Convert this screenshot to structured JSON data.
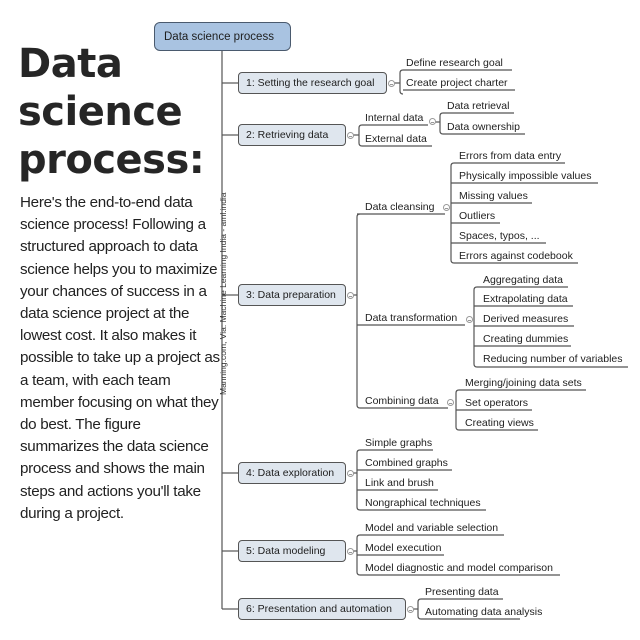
{
  "heading": {
    "title_lines": [
      "Data",
      "science",
      "process:"
    ],
    "description": "Here's the end-to-end data science process! Following a structured approach to data science helps you to maximize your chances of success in a data science project at the lowest cost. It also makes it possible to take up a project as a team, with each team member focusing on what they do best. The figure summarizes the data science process and shows the main steps and actions you'll take during a project."
  },
  "mindmap": {
    "root": "Data science process",
    "credit": "Manning.com, Via: Machine Learning India - aml.india",
    "steps": [
      {
        "label": "1: Setting the research goal",
        "children": [
          "Define research goal",
          "Create project charter"
        ]
      },
      {
        "label": "2: Retrieving data",
        "children": [
          {
            "label": "Internal data",
            "children": [
              "Data retrieval",
              "Data ownership"
            ]
          },
          {
            "label": "External data"
          }
        ]
      },
      {
        "label": "3: Data preparation",
        "children": [
          {
            "label": "Data cleansing",
            "children": [
              "Errors from data entry",
              "Physically impossible values",
              "Missing values",
              "Outliers",
              "Spaces, typos, ...",
              "Errors against codebook"
            ]
          },
          {
            "label": "Data transformation",
            "children": [
              "Aggregating data",
              "Extrapolating data",
              "Derived measures",
              "Creating dummies",
              "Reducing number of variables"
            ]
          },
          {
            "label": "Combining data",
            "children": [
              "Merging/joining data sets",
              "Set operators",
              "Creating views"
            ]
          }
        ]
      },
      {
        "label": "4: Data exploration",
        "children": [
          "Simple graphs",
          "Combined graphs",
          "Link and brush",
          "Nongraphical techniques"
        ]
      },
      {
        "label": "5: Data modeling",
        "children": [
          "Model and variable selection",
          "Model execution",
          "Model diagnostic and model comparison"
        ]
      },
      {
        "label": "6: Presentation and automation",
        "children": [
          "Presenting data",
          "Automating data analysis"
        ]
      }
    ]
  },
  "colors": {
    "root_fill": "#a9c3e1",
    "step_fill": "#dfe6ee",
    "line": "#555555"
  }
}
